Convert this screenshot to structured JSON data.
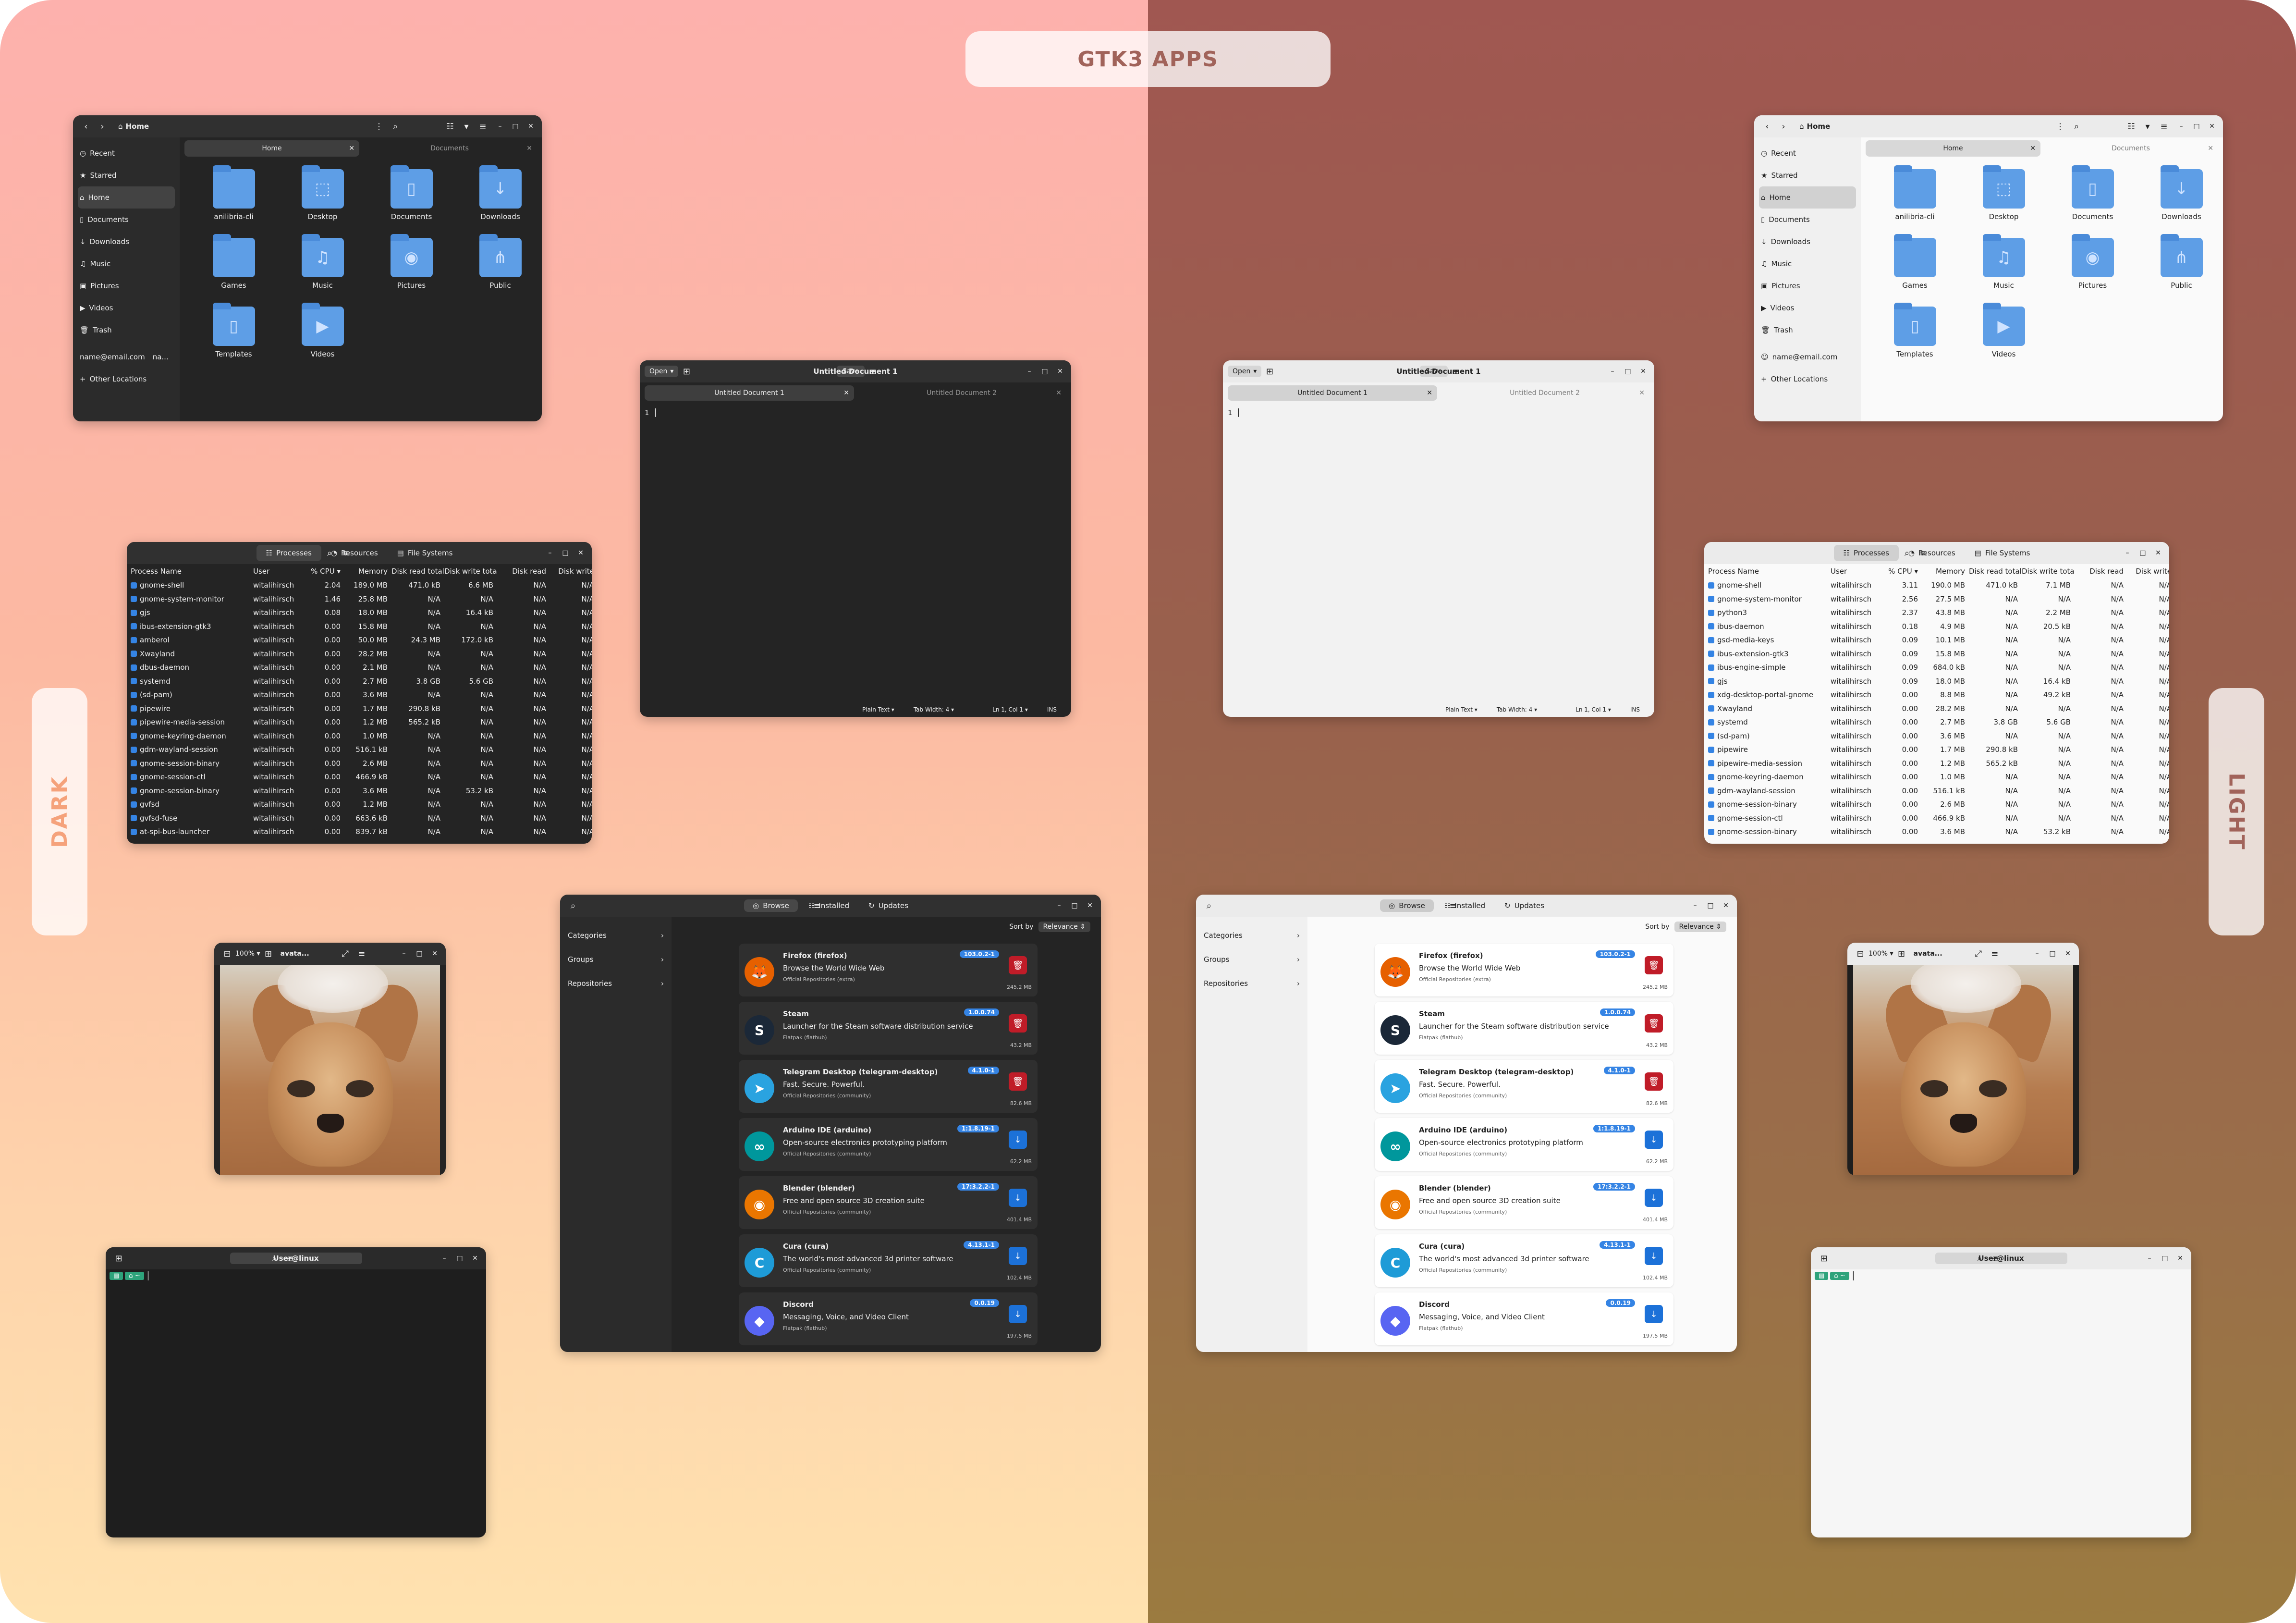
{
  "header": {
    "title": "GTK3 APPS",
    "dark_label": "DARK",
    "light_label": "LIGHT"
  },
  "files": {
    "path": "Home",
    "sidebar": [
      "Recent",
      "Starred",
      "Home",
      "Documents",
      "Downloads",
      "Music",
      "Pictures",
      "Videos",
      "Trash"
    ],
    "account_dark": "name@email.com",
    "account_dark_extra": "na...",
    "account_light": "name@email.com",
    "other_locations": "Other Locations",
    "tabs": [
      "Home",
      "Documents"
    ],
    "folders": [
      "anilibria-cli",
      "Desktop",
      "Documents",
      "Downloads",
      "Games",
      "Music",
      "Pictures",
      "Public",
      "Templates",
      "Videos"
    ]
  },
  "editor": {
    "open_label": "Open",
    "title": "Untitled Document 1",
    "save_label": "Save",
    "tabs": [
      "Untitled Document 1",
      "Untitled Document 2"
    ],
    "line": "1",
    "status": {
      "lang": "Plain Text",
      "tab_width": "Tab Width: 4",
      "pos": "Ln 1, Col 1",
      "mode": "INS"
    }
  },
  "sysmon": {
    "tabs": [
      "Processes",
      "Resources",
      "File Systems"
    ],
    "columns": [
      "Process Name",
      "User",
      "% CPU",
      "Memory",
      "Disk read total",
      "Disk write total",
      "Disk read",
      "Disk write"
    ],
    "dark_rows": [
      [
        "gnome-shell",
        "witalihirsch",
        "2.04",
        "189.0 MB",
        "471.0 kB",
        "6.6 MB",
        "N/A",
        "N/A"
      ],
      [
        "gnome-system-monitor",
        "witalihirsch",
        "1.46",
        "25.8 MB",
        "N/A",
        "N/A",
        "N/A",
        "N/A"
      ],
      [
        "gjs",
        "witalihirsch",
        "0.08",
        "18.0 MB",
        "N/A",
        "16.4 kB",
        "N/A",
        "N/A"
      ],
      [
        "ibus-extension-gtk3",
        "witalihirsch",
        "0.00",
        "15.8 MB",
        "N/A",
        "N/A",
        "N/A",
        "N/A"
      ],
      [
        "amberol",
        "witalihirsch",
        "0.00",
        "50.0 MB",
        "24.3 MB",
        "172.0 kB",
        "N/A",
        "N/A"
      ],
      [
        "Xwayland",
        "witalihirsch",
        "0.00",
        "28.2 MB",
        "N/A",
        "N/A",
        "N/A",
        "N/A"
      ],
      [
        "dbus-daemon",
        "witalihirsch",
        "0.00",
        "2.1 MB",
        "N/A",
        "N/A",
        "N/A",
        "N/A"
      ],
      [
        "systemd",
        "witalihirsch",
        "0.00",
        "2.7 MB",
        "3.8 GB",
        "5.6 GB",
        "N/A",
        "N/A"
      ],
      [
        "(sd-pam)",
        "witalihirsch",
        "0.00",
        "3.6 MB",
        "N/A",
        "N/A",
        "N/A",
        "N/A"
      ],
      [
        "pipewire",
        "witalihirsch",
        "0.00",
        "1.7 MB",
        "290.8 kB",
        "N/A",
        "N/A",
        "N/A"
      ],
      [
        "pipewire-media-session",
        "witalihirsch",
        "0.00",
        "1.2 MB",
        "565.2 kB",
        "N/A",
        "N/A",
        "N/A"
      ],
      [
        "gnome-keyring-daemon",
        "witalihirsch",
        "0.00",
        "1.0 MB",
        "N/A",
        "N/A",
        "N/A",
        "N/A"
      ],
      [
        "gdm-wayland-session",
        "witalihirsch",
        "0.00",
        "516.1 kB",
        "N/A",
        "N/A",
        "N/A",
        "N/A"
      ],
      [
        "gnome-session-binary",
        "witalihirsch",
        "0.00",
        "2.6 MB",
        "N/A",
        "N/A",
        "N/A",
        "N/A"
      ],
      [
        "gnome-session-ctl",
        "witalihirsch",
        "0.00",
        "466.9 kB",
        "N/A",
        "N/A",
        "N/A",
        "N/A"
      ],
      [
        "gnome-session-binary",
        "witalihirsch",
        "0.00",
        "3.6 MB",
        "N/A",
        "53.2 kB",
        "N/A",
        "N/A"
      ],
      [
        "gvfsd",
        "witalihirsch",
        "0.00",
        "1.2 MB",
        "N/A",
        "N/A",
        "N/A",
        "N/A"
      ],
      [
        "gvfsd-fuse",
        "witalihirsch",
        "0.00",
        "663.6 kB",
        "N/A",
        "N/A",
        "N/A",
        "N/A"
      ],
      [
        "at-spi-bus-launcher",
        "witalihirsch",
        "0.00",
        "839.7 kB",
        "N/A",
        "N/A",
        "N/A",
        "N/A"
      ]
    ],
    "light_rows": [
      [
        "gnome-shell",
        "witalihirsch",
        "3.11",
        "190.0 MB",
        "471.0 kB",
        "7.1 MB",
        "N/A",
        "N/A"
      ],
      [
        "gnome-system-monitor",
        "witalihirsch",
        "2.56",
        "27.5 MB",
        "N/A",
        "N/A",
        "N/A",
        "N/A"
      ],
      [
        "python3",
        "witalihirsch",
        "2.37",
        "43.8 MB",
        "N/A",
        "2.2 MB",
        "N/A",
        "N/A"
      ],
      [
        "ibus-daemon",
        "witalihirsch",
        "0.18",
        "4.9 MB",
        "N/A",
        "20.5 kB",
        "N/A",
        "N/A"
      ],
      [
        "gsd-media-keys",
        "witalihirsch",
        "0.09",
        "10.1 MB",
        "N/A",
        "N/A",
        "N/A",
        "N/A"
      ],
      [
        "ibus-extension-gtk3",
        "witalihirsch",
        "0.09",
        "15.8 MB",
        "N/A",
        "N/A",
        "N/A",
        "N/A"
      ],
      [
        "ibus-engine-simple",
        "witalihirsch",
        "0.09",
        "684.0 kB",
        "N/A",
        "N/A",
        "N/A",
        "N/A"
      ],
      [
        "gjs",
        "witalihirsch",
        "0.09",
        "18.0 MB",
        "N/A",
        "16.4 kB",
        "N/A",
        "N/A"
      ],
      [
        "xdg-desktop-portal-gnome",
        "witalihirsch",
        "0.00",
        "8.8 MB",
        "N/A",
        "49.2 kB",
        "N/A",
        "N/A"
      ],
      [
        "Xwayland",
        "witalihirsch",
        "0.00",
        "28.2 MB",
        "N/A",
        "N/A",
        "N/A",
        "N/A"
      ],
      [
        "systemd",
        "witalihirsch",
        "0.00",
        "2.7 MB",
        "3.8 GB",
        "5.6 GB",
        "N/A",
        "N/A"
      ],
      [
        "(sd-pam)",
        "witalihirsch",
        "0.00",
        "3.6 MB",
        "N/A",
        "N/A",
        "N/A",
        "N/A"
      ],
      [
        "pipewire",
        "witalihirsch",
        "0.00",
        "1.7 MB",
        "290.8 kB",
        "N/A",
        "N/A",
        "N/A"
      ],
      [
        "pipewire-media-session",
        "witalihirsch",
        "0.00",
        "1.2 MB",
        "565.2 kB",
        "N/A",
        "N/A",
        "N/A"
      ],
      [
        "gnome-keyring-daemon",
        "witalihirsch",
        "0.00",
        "1.0 MB",
        "N/A",
        "N/A",
        "N/A",
        "N/A"
      ],
      [
        "gdm-wayland-session",
        "witalihirsch",
        "0.00",
        "516.1 kB",
        "N/A",
        "N/A",
        "N/A",
        "N/A"
      ],
      [
        "gnome-session-binary",
        "witalihirsch",
        "0.00",
        "2.6 MB",
        "N/A",
        "N/A",
        "N/A",
        "N/A"
      ],
      [
        "gnome-session-ctl",
        "witalihirsch",
        "0.00",
        "466.9 kB",
        "N/A",
        "N/A",
        "N/A",
        "N/A"
      ],
      [
        "gnome-session-binary",
        "witalihirsch",
        "0.00",
        "3.6 MB",
        "N/A",
        "53.2 kB",
        "N/A",
        "N/A"
      ]
    ]
  },
  "imageviewer": {
    "zoom": "100%",
    "title": "avata..."
  },
  "terminal": {
    "title": "User@linux",
    "prompt": "~"
  },
  "software": {
    "tabs": [
      "Browse",
      "Installed",
      "Updates"
    ],
    "sidebar": [
      "Categories",
      "Groups",
      "Repositories"
    ],
    "sort_label": "Sort by",
    "sort_value": "Relevance",
    "apps": [
      {
        "name": "Firefox (firefox)",
        "desc": "Browse the World Wide Web",
        "src": "Official Repositories (extra)",
        "ver": "103.0.2-1",
        "size": "245.2 MB",
        "action": "remove",
        "color": "#e66000",
        "glyph": "🦊"
      },
      {
        "name": "Steam",
        "desc": "Launcher for the Steam software distribution service",
        "src": "Flatpak (flathub)",
        "ver": "1.0.0.74",
        "size": "43.2 MB",
        "action": "remove",
        "color": "#1b2838",
        "glyph": "S"
      },
      {
        "name": "Telegram Desktop (telegram-desktop)",
        "desc": "Fast. Secure. Powerful.",
        "src": "Official Repositories (community)",
        "ver": "4.1.0-1",
        "size": "82.6 MB",
        "action": "remove",
        "color": "#2aa3e0",
        "glyph": "➤"
      },
      {
        "name": "Arduino IDE (arduino)",
        "desc": "Open-source electronics prototyping platform",
        "src": "Official Repositories (community)",
        "ver": "1:1.8.19-1",
        "size": "62.2 MB",
        "action": "install",
        "color": "#00979c",
        "glyph": "∞"
      },
      {
        "name": "Blender (blender)",
        "desc": "Free and open source 3D creation suite",
        "src": "Official Repositories (community)",
        "ver": "17:3.2.2-1",
        "size": "401.4 MB",
        "action": "install",
        "color": "#ea7600",
        "glyph": "◉"
      },
      {
        "name": "Cura (cura)",
        "desc": "The world's most advanced 3d printer software",
        "src": "Official Repositories (community)",
        "ver": "4.13.1-1",
        "size": "102.4 MB",
        "action": "install",
        "color": "#1e9bd7",
        "glyph": "C"
      },
      {
        "name": "Discord",
        "desc": "Messaging, Voice, and Video Client",
        "src": "Flatpak (flathub)",
        "ver": "0.0.19",
        "size": "197.5 MB",
        "action": "install",
        "color": "#5865f2",
        "glyph": "◆"
      }
    ]
  }
}
